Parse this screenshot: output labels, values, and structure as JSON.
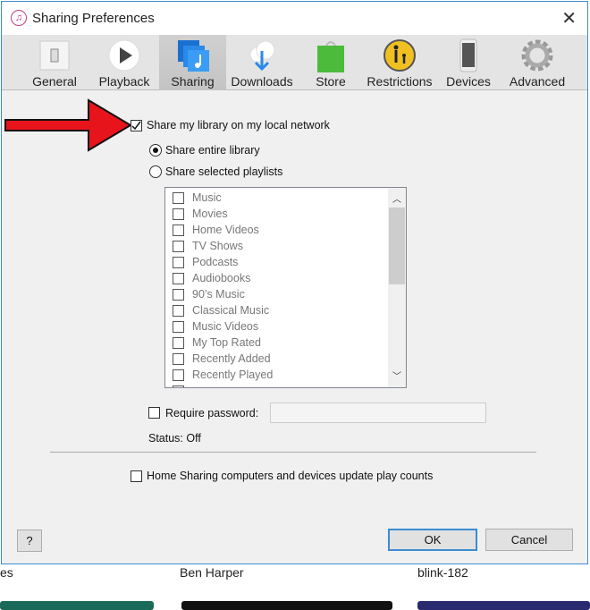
{
  "window": {
    "title": "Sharing Preferences"
  },
  "toolbar": {
    "tabs": [
      {
        "label": "General",
        "icon": "switch-icon"
      },
      {
        "label": "Playback",
        "icon": "play-icon"
      },
      {
        "label": "Sharing",
        "icon": "sharing-music-icon",
        "selected": true
      },
      {
        "label": "Downloads",
        "icon": "cloud-download-icon"
      },
      {
        "label": "Store",
        "icon": "shopping-bag-icon"
      },
      {
        "label": "Restrictions",
        "icon": "parental-icon"
      },
      {
        "label": "Devices",
        "icon": "phone-icon"
      },
      {
        "label": "Advanced",
        "icon": "gear-icon"
      }
    ]
  },
  "sharing": {
    "share_library": {
      "label": "Share my library on my local network",
      "checked": true
    },
    "share_entire": {
      "label": "Share entire library",
      "selected": true
    },
    "share_selected": {
      "label": "Share selected playlists",
      "selected": false
    },
    "playlists": [
      "Music",
      "Movies",
      "Home Videos",
      "TV Shows",
      "Podcasts",
      "Audiobooks",
      "90’s Music",
      "Classical Music",
      "Music Videos",
      "My Top Rated",
      "Recently Added",
      "Recently Played"
    ],
    "require_password": {
      "label": "Require password:",
      "checked": false,
      "value": ""
    },
    "status": "Status: Off",
    "home_sharing": {
      "label": "Home Sharing computers and devices update play counts",
      "checked": false
    }
  },
  "buttons": {
    "help": "?",
    "ok": "OK",
    "cancel": "Cancel"
  },
  "background": {
    "items": [
      "es",
      "Ben Harper",
      "blink-182"
    ]
  },
  "colors": {
    "accent": "#3c8cd0",
    "annotation_arrow": "#e8141c"
  }
}
